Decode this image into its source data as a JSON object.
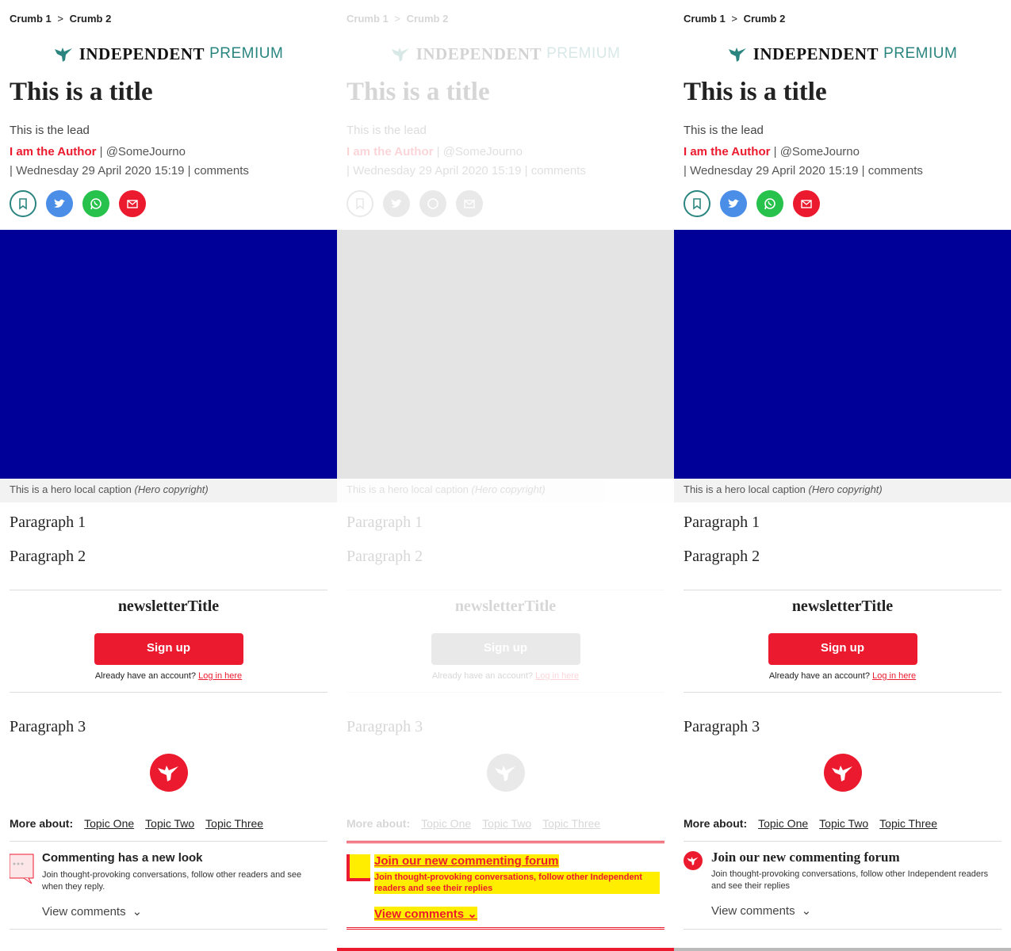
{
  "breadcrumb": {
    "crumb1": "Crumb 1",
    "sep": ">",
    "crumb2": "Crumb 2"
  },
  "logo": {
    "name": "INDEPENDENT",
    "tier": "PREMIUM"
  },
  "article": {
    "title": "This is a title",
    "lead": "This is the lead",
    "author": "I am the Author",
    "handle": "@SomeJourno",
    "date": "Wednesday 29 April 2020 15:19",
    "comments": "comments",
    "hero_caption": "This is a hero local caption",
    "hero_copyright": "(Hero copyright)",
    "paragraph1": "Paragraph 1",
    "paragraph2": "Paragraph 2",
    "paragraph3": "Paragraph 3"
  },
  "share": {
    "icons": [
      "bookmark-icon",
      "twitter-icon",
      "whatsapp-icon",
      "email-icon"
    ]
  },
  "newsletter": {
    "title": "newsletterTitle",
    "button": "Sign up",
    "have_account": "Already have an account?",
    "login": "Log in here"
  },
  "topics": {
    "label": "More about:",
    "items": [
      "Topic One",
      "Topic Two",
      "Topic Three"
    ]
  },
  "comments_old": {
    "title": "Commenting has a new look",
    "desc": "Join thought-provoking conversations, follow other readers and see when they reply.",
    "view": "View comments"
  },
  "comments_new": {
    "title": "Join our new commenting forum",
    "desc": "Join thought-provoking conversations, follow other Independent readers and see their replies",
    "view": "View comments"
  },
  "colors": {
    "accent": "#ec1a2e",
    "premium": "#2a8580",
    "hero": "#000099",
    "twitter": "#4b8ee8",
    "whatsapp": "#27c24c"
  }
}
